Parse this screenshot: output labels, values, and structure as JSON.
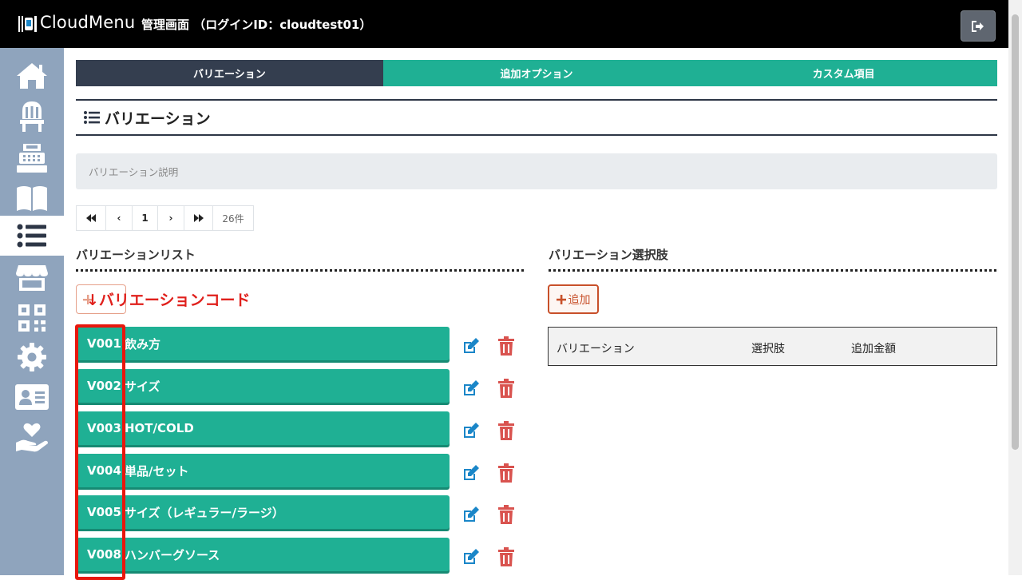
{
  "header": {
    "brand": "CloudMenu",
    "admin_title": "管理画面 （ログインID：cloudtest01）"
  },
  "sidebar": {
    "items": [
      {
        "name": "home-icon"
      },
      {
        "name": "chair-icon"
      },
      {
        "name": "register-icon"
      },
      {
        "name": "book-icon"
      },
      {
        "name": "list-icon",
        "active": true
      },
      {
        "name": "store-icon"
      },
      {
        "name": "qr-icon"
      },
      {
        "name": "gear-icon"
      },
      {
        "name": "id-card-icon"
      },
      {
        "name": "hand-heart-icon"
      }
    ]
  },
  "tabs": [
    {
      "label": "バリエーション",
      "active": true
    },
    {
      "label": "追加オプション"
    },
    {
      "label": "カスタム項目"
    }
  ],
  "section": {
    "title": "バリエーション",
    "description": "バリエーション説明"
  },
  "pagination": {
    "first": "⏮",
    "prev": "‹",
    "page": "1",
    "next": "›",
    "last": "⏭",
    "count": "26件"
  },
  "left_panel": {
    "heading": "バリエーションリスト",
    "overlay_label": "↓バリエーションコード",
    "rows": [
      {
        "code": "V001",
        "name": "飲み方"
      },
      {
        "code": "V002",
        "name": "サイズ"
      },
      {
        "code": "V003",
        "name": "HOT/COLD"
      },
      {
        "code": "V004",
        "name": "単品/セット"
      },
      {
        "code": "V005",
        "name": "サイズ（レギュラー/ラージ）"
      },
      {
        "code": "V008",
        "name": "ハンバーグソース"
      }
    ]
  },
  "right_panel": {
    "heading": "バリエーション選択肢",
    "add_label": "追加",
    "table_headers": [
      "バリエーション",
      "選択肢",
      "追加金額"
    ]
  },
  "colors": {
    "accent_green": "#1fb094",
    "dark_tab": "#343e4f",
    "sidebar": "#8fa4bd",
    "edit_blue": "#1a86c8",
    "delete_red": "#d9534f",
    "highlight_red": "#e8170d"
  }
}
